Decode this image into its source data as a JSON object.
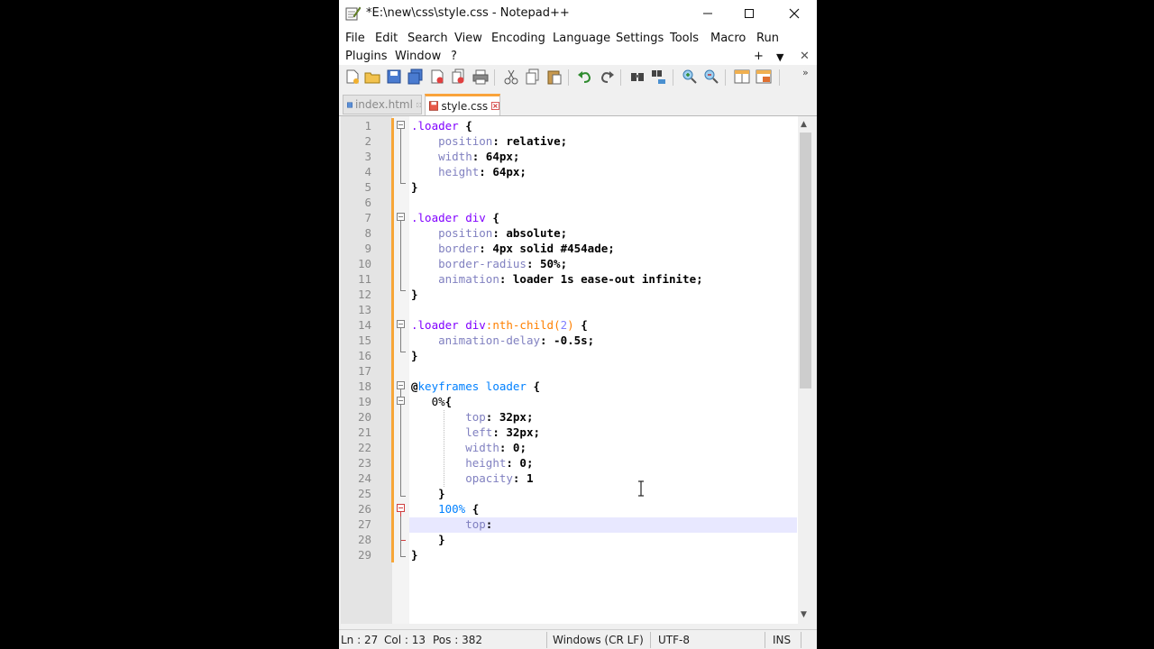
{
  "window": {
    "title": "*E:\\new\\css\\style.css - Notepad++"
  },
  "menu": {
    "row1": [
      "File",
      "Edit",
      "Search",
      "View",
      "Encoding",
      "Language",
      "Settings",
      "Tools",
      "Macro",
      "Run"
    ],
    "row2": [
      "Plugins",
      "Window",
      "?"
    ],
    "controls": [
      "+",
      "▼",
      "✕"
    ]
  },
  "toolbar": {
    "icons": [
      "new-file-icon",
      "open-file-icon",
      "save-icon",
      "save-all-icon",
      "close-icon",
      "close-all-icon",
      "print-icon",
      "cut-icon",
      "copy-icon",
      "paste-icon",
      "undo-icon",
      "redo-icon",
      "find-icon",
      "replace-icon",
      "zoom-in-icon",
      "zoom-out-icon",
      "sync-v-icon",
      "sync-h-icon"
    ],
    "overflow": "»"
  },
  "tabs": [
    {
      "label": "index.html",
      "active": false
    },
    {
      "label": "style.css",
      "active": true
    }
  ],
  "editor": {
    "line_numbers": [
      "1",
      "2",
      "3",
      "4",
      "5",
      "6",
      "7",
      "8",
      "9",
      "10",
      "11",
      "12",
      "13",
      "14",
      "15",
      "16",
      "17",
      "18",
      "19",
      "20",
      "21",
      "22",
      "23",
      "24",
      "25",
      "26",
      "27",
      "28",
      "29"
    ],
    "current_line": 27,
    "lines": [
      ".loader {",
      "    position: relative;",
      "    width: 64px;",
      "    height: 64px;",
      "}",
      "",
      ".loader div {",
      "    position: absolute;",
      "    border: 4px solid #454ade;",
      "    border-radius: 50%;",
      "    animation: loader 1s ease-out infinite;",
      "}",
      "",
      ".loader div:nth-child(2) {",
      "    animation-delay: -0.5s;",
      "}",
      "",
      "@keyframes loader {",
      "   0%{",
      "        top: 32px;",
      "        left: 32px;",
      "        width: 0;",
      "        height: 0;",
      "        opacity: 1",
      "    }",
      "    100% {",
      "        top:",
      "    }",
      "}"
    ]
  },
  "status": {
    "line": "Ln : 27",
    "col": "Col : 13",
    "pos": "Pos : 382",
    "eol": "Windows (CR LF)",
    "encoding": "UTF-8",
    "mode": "INS"
  },
  "colors": {
    "tab_accent": "#f9a33b",
    "change_bar": "#f7a638",
    "selector": "#8000ff",
    "property": "#8080c0",
    "at_rule": "#0080ff",
    "current_line": "#e8e8ff"
  }
}
